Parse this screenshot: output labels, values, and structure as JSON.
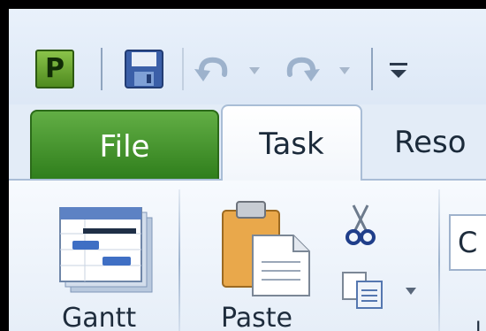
{
  "quick_access": {
    "app_logo_letter": "P",
    "icons": [
      "save-icon",
      "undo-icon",
      "redo-icon",
      "customize-quick-access-icon"
    ]
  },
  "tabs": {
    "file": "File",
    "task": "Task",
    "resource": "Reso"
  },
  "ribbon": {
    "gantt_label": "Gantt",
    "paste_label": "Paste",
    "combo_value": "C",
    "fragment": "I"
  },
  "colors": {
    "file_tab": "#2e7d1b",
    "ribbon_bg": "#e6eef8",
    "frame": "#000000"
  }
}
